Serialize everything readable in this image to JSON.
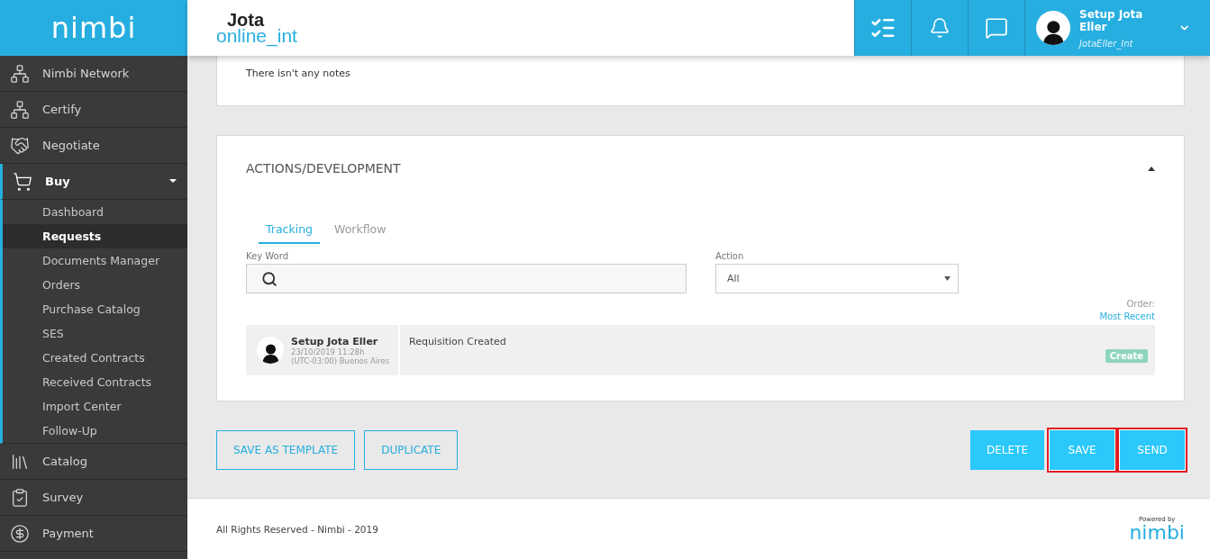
{
  "brand": {
    "logo": "nimbi",
    "company_top": "Jota",
    "company_bottom": "online_int"
  },
  "header": {
    "user_name": "Setup Jota Eller",
    "user_login": "JotaEller_Int"
  },
  "sidebar": {
    "items": [
      {
        "label": "Nimbi Network",
        "expanded": false
      },
      {
        "label": "Certify",
        "expanded": false
      },
      {
        "label": "Negotiate",
        "expanded": false
      },
      {
        "label": "Buy",
        "expanded": true,
        "children": [
          {
            "label": "Dashboard",
            "selected": false
          },
          {
            "label": "Requests",
            "selected": true
          },
          {
            "label": "Documents Manager",
            "selected": false
          },
          {
            "label": "Orders",
            "selected": false
          },
          {
            "label": "Purchase Catalog",
            "selected": false
          },
          {
            "label": "SES",
            "selected": false
          },
          {
            "label": "Created Contracts",
            "selected": false
          },
          {
            "label": "Received Contracts",
            "selected": false
          },
          {
            "label": "Import Center",
            "selected": false
          },
          {
            "label": "Follow-Up",
            "selected": false
          }
        ]
      },
      {
        "label": "Catalog",
        "expanded": false
      },
      {
        "label": "Survey",
        "expanded": false
      },
      {
        "label": "Payment",
        "expanded": false
      }
    ]
  },
  "notes": {
    "text": "There isn't any notes"
  },
  "actions_panel": {
    "title": "ACTIONS/DEVELOPMENT",
    "expanded": true,
    "tabs": [
      {
        "label": "Tracking",
        "selected": true
      },
      {
        "label": "Workflow",
        "selected": false
      }
    ],
    "keyword": {
      "label": "Key Word"
    },
    "action_filter": {
      "label": "Action",
      "value": "All"
    },
    "order_label": "Order:",
    "order_value": "Most Recent",
    "entries": [
      {
        "user": "Setup Jota Eller",
        "date": "23/10/2019  11:28h",
        "timezone": "(UTC-03:00) Buenos Aires",
        "description": "Requisition Created",
        "tag": "Create",
        "color": "#8fd5be"
      }
    ]
  },
  "buttons": [
    {
      "label": "SAVE AS TEMPLATE",
      "kind": "outline",
      "highlighted": false
    },
    {
      "label": "DUPLICATE",
      "kind": "outline",
      "highlighted": false
    },
    {
      "label": "DELETE",
      "kind": "filled",
      "highlighted": false
    },
    {
      "label": "SAVE",
      "kind": "filled",
      "highlighted": true
    },
    {
      "label": "SEND",
      "kind": "filled",
      "highlighted": true
    }
  ],
  "footer": {
    "text": "All Rights Reserved - Nimbi - 2019",
    "powered_by": "Powered by",
    "powered_logo": "nimbi"
  }
}
